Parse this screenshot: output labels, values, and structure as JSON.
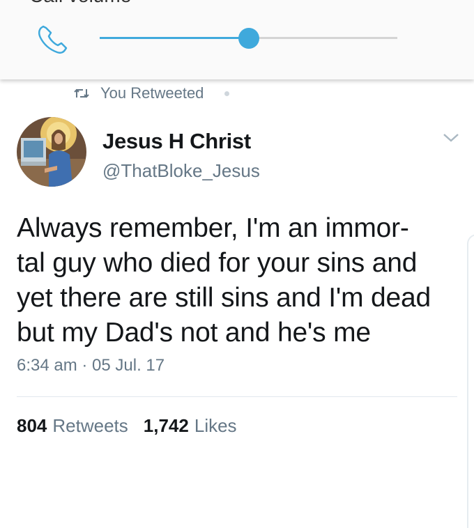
{
  "volume_panel": {
    "title": "Call volume",
    "icon": "phone-icon",
    "level": 0.5,
    "accent_color": "#3fa9dc"
  },
  "tweet": {
    "retweet_label": "You Retweeted",
    "author_name": "Jesus H Christ",
    "author_handle": "@ThatBloke_Jesus",
    "text": "Always remember, I'm an immor-\ntal guy who died for your sins and\nyet there are still sins and I'm dead\nbut my Dad's not and he's me",
    "timestamp": "6:34 am · 05 Jul. 17",
    "retweet_count": "804",
    "retweet_count_label": "Retweets",
    "like_count": "1,742",
    "like_count_label": "Likes"
  }
}
